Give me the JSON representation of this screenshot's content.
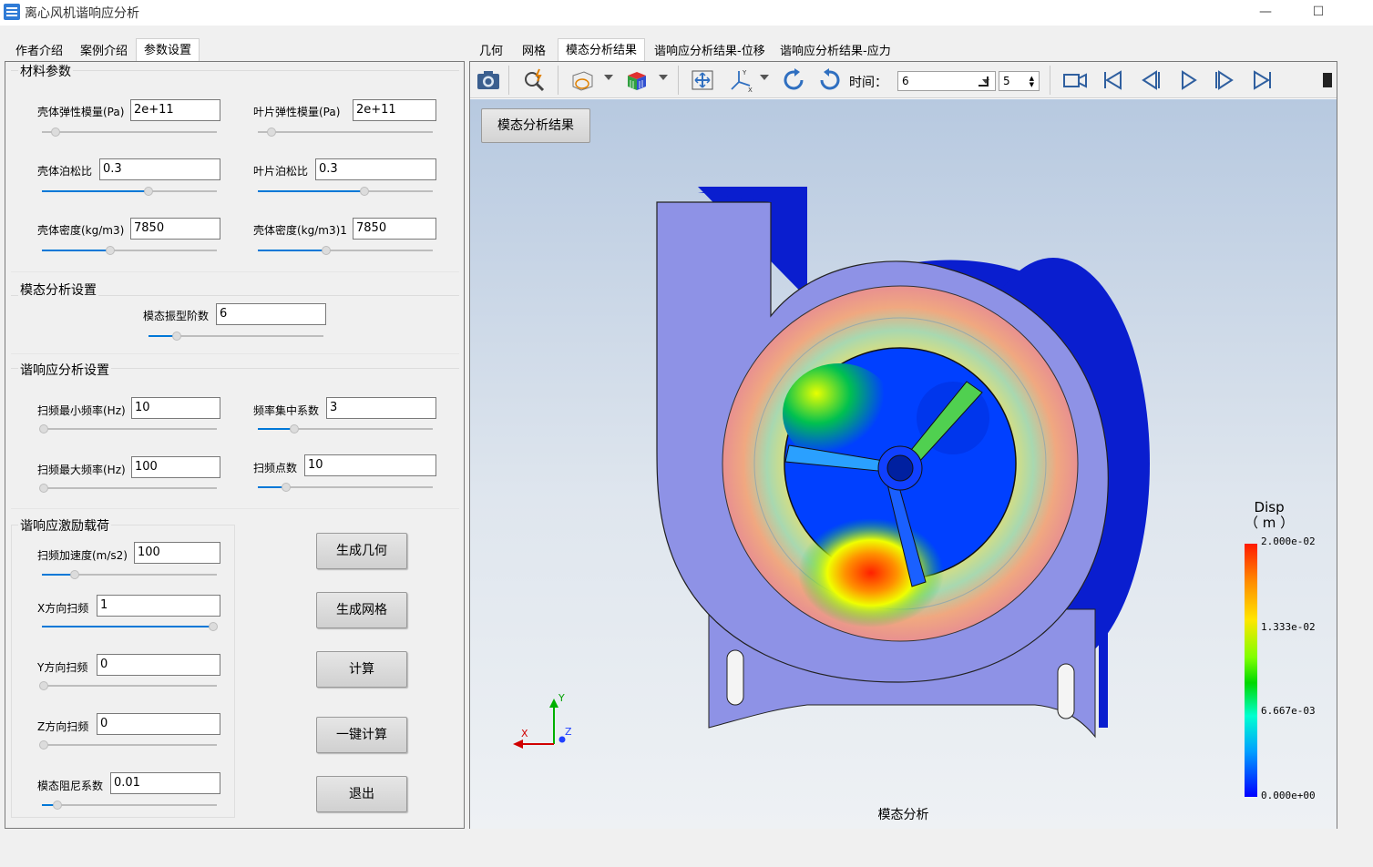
{
  "window": {
    "title": "离心风机谐响应分析",
    "minimize": "—",
    "maximize": "☐"
  },
  "left_tabs": [
    "作者介绍",
    "案例介绍",
    "参数设置"
  ],
  "right_tabs": [
    "几何",
    "网格",
    "模态分析结果",
    "谐响应分析结果-位移",
    "谐响应分析结果-应力"
  ],
  "material": {
    "title": "材料参数",
    "shell_modulus_label": "壳体弹性模量(Pa)",
    "shell_modulus": "2e+11",
    "blade_modulus_label": "叶片弹性模量(Pa)",
    "blade_modulus": "2e+11",
    "shell_poisson_label": "壳体泊松比",
    "shell_poisson": "0.3",
    "blade_poisson_label": "叶片泊松比",
    "blade_poisson": "0.3",
    "shell_density_label": "壳体密度(kg/m3)",
    "shell_density": "7850",
    "shell_density1_label": "壳体密度(kg/m3)1",
    "shell_density1": "7850"
  },
  "modal": {
    "title": "模态分析设置",
    "order_label": "模态振型阶数",
    "order": "6"
  },
  "harmonic": {
    "title": "谐响应分析设置",
    "fmin_label": "扫频最小频率(Hz)",
    "fmin": "10",
    "concentration_label": "频率集中系数",
    "concentration": "3",
    "fmax_label": "扫频最大频率(Hz)",
    "fmax": "100",
    "points_label": "扫频点数",
    "points": "10"
  },
  "excitation": {
    "title": "谐响应激励载荷",
    "accel_label": "扫频加速度(m/s2)",
    "accel": "100",
    "x_label": "X方向扫频",
    "x": "1",
    "y_label": "Y方向扫频",
    "y": "0",
    "z_label": "Z方向扫频",
    "z": "0",
    "damping_label": "模态阻尼系数",
    "damping": "0.01"
  },
  "buttons": {
    "gen_geometry": "生成几何",
    "gen_mesh": "生成网格",
    "compute": "计算",
    "one_click": "一键计算",
    "exit": "退出"
  },
  "toolbar": {
    "time_label": "时间：",
    "time_value": "6",
    "step_value": "5"
  },
  "viewport": {
    "result_button": "模态分析结果",
    "caption": "模态分析",
    "legend_title_line1": "Disp",
    "legend_title_line2": "（ m ）",
    "legend_max": "2.000e-02",
    "legend_mid_high": "1.333e-02",
    "legend_mid_low": "6.667e-03",
    "legend_min": "0.000e+00",
    "axis_x": "X",
    "axis_y": "Y",
    "axis_z": "Z"
  },
  "colors": {
    "accent": "#0078d7",
    "fan_shell": "#8e92e6",
    "fan_side": "#0a1ecf"
  }
}
